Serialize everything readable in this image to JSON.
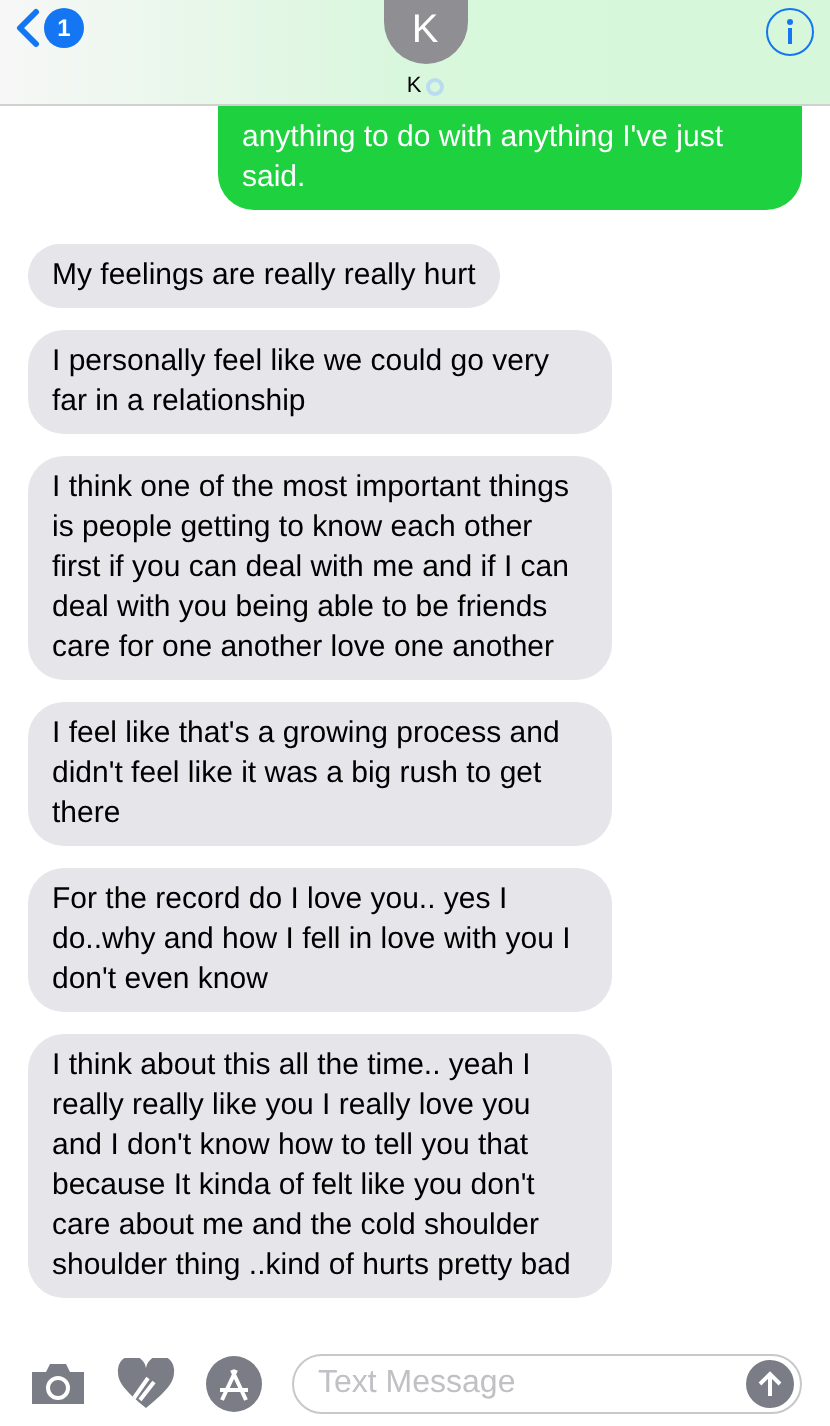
{
  "header": {
    "back_badge": "1",
    "avatar_initial": "K",
    "name": "K"
  },
  "messages": [
    {
      "kind": "sent",
      "text": "anything to do with anything I've just said."
    },
    {
      "kind": "received",
      "text": "My feelings are really really hurt"
    },
    {
      "kind": "received",
      "text": "I personally feel like we could go very far in a relationship"
    },
    {
      "kind": "received",
      "text": "I think one of the most important things is people getting to know each other first if you can deal with me and if I can deal with you being able to be friends care for one another love one another"
    },
    {
      "kind": "received",
      "text": "I feel like that's a growing process and didn't feel like it was a big rush to get there"
    },
    {
      "kind": "received",
      "text": "For the record do I love you.. yes I do..why and how I fell in love with you I don't even know"
    },
    {
      "kind": "received",
      "text": "I think about this all the time.. yeah I really really like you I really love you and I don't know how to tell you that because It kinda of felt like you don't care about me and the cold shoulder shoulder thing ..kind of hurts pretty bad"
    }
  ],
  "composer": {
    "placeholder": "Text Message"
  }
}
